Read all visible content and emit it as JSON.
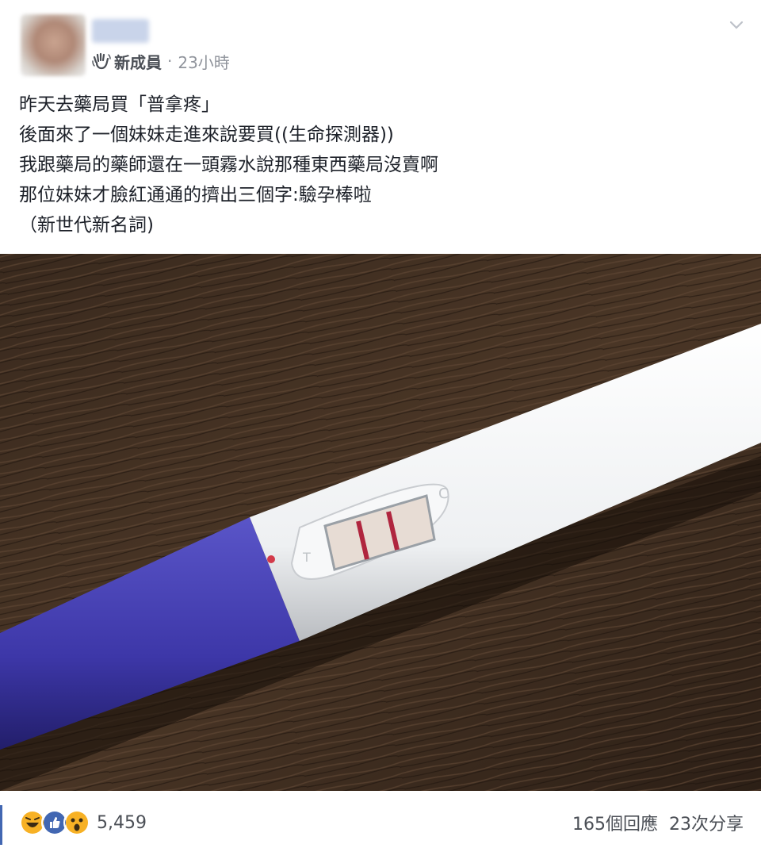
{
  "post": {
    "author_badge": "新成員",
    "separator": "·",
    "time": "23小時",
    "icons": {
      "badge": "hand-wave-icon",
      "menu": "chevron-down-icon"
    },
    "text_lines": [
      "昨天去藥局買「普拿疼」",
      "後面來了一個妹妹走進來說要買((生命探測器))",
      "我跟藥局的藥師還在一頭霧水說那種東西藥局沒賣啊",
      "那位妹妹才臉紅通通的擠出三個字:驗孕棒啦",
      "（新世代新名詞)"
    ]
  },
  "photo": {
    "subject": "pregnancy-test-stick"
  },
  "footer": {
    "reactions": [
      {
        "name": "haha-reaction-icon",
        "color": "#f7b125"
      },
      {
        "name": "like-reaction-icon",
        "color": "#4267b2"
      },
      {
        "name": "wow-reaction-icon",
        "color": "#f7b125"
      }
    ],
    "reaction_count": "5,459",
    "comments": "165個回應",
    "shares": "23次分享"
  }
}
